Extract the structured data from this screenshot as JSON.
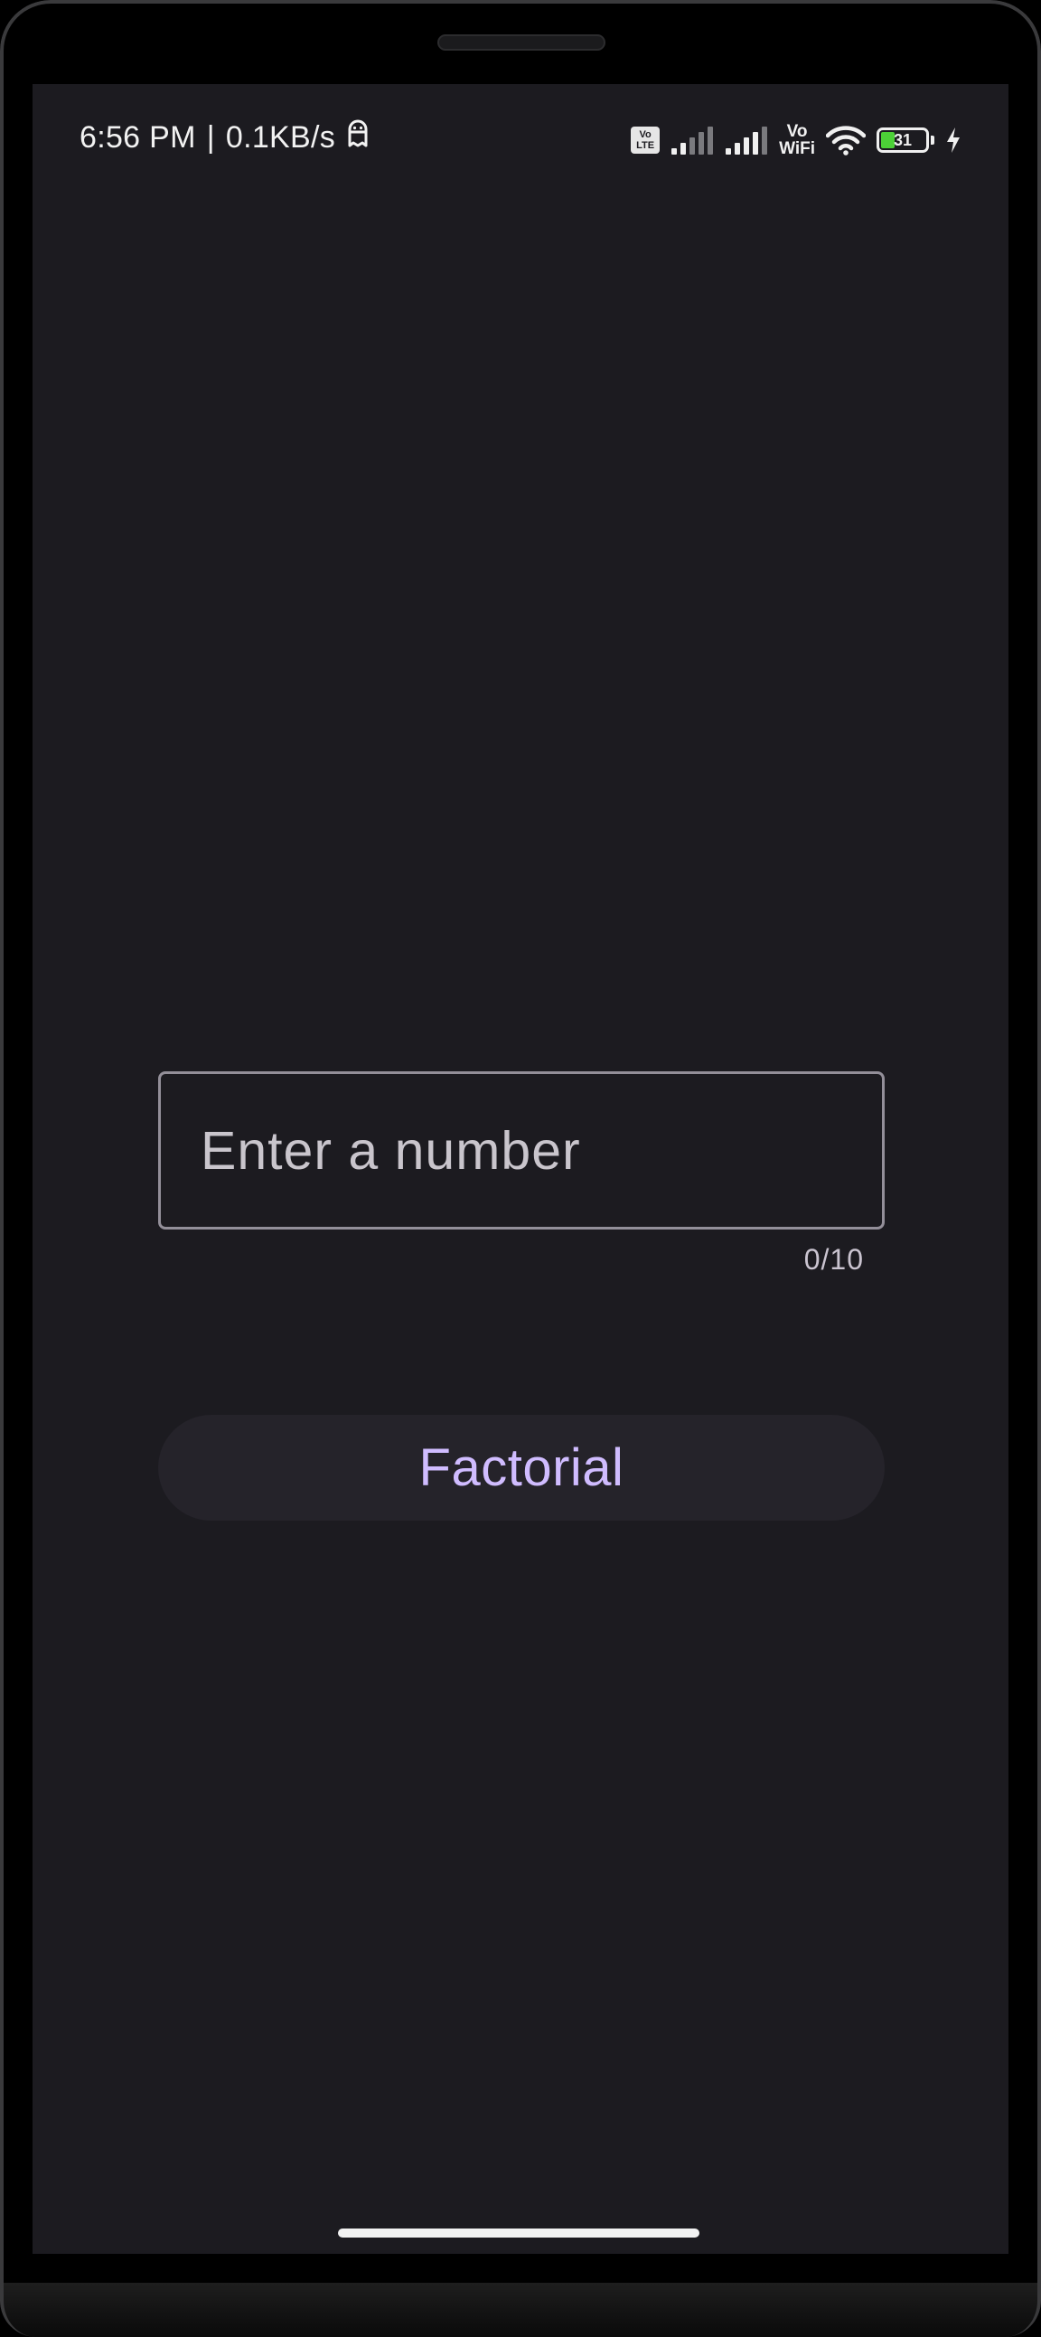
{
  "status_bar": {
    "time": "6:56 PM",
    "separator": "|",
    "network_speed": "0.1KB/s",
    "volte_badge": [
      "Vo",
      "LTE"
    ],
    "vowifi_label": [
      "Vo",
      "WiFi"
    ],
    "battery_level": "31",
    "battery_percent": 31,
    "icons": [
      "ghost-icon",
      "volte-icon",
      "signal-icon",
      "signal-icon",
      "vowifi-icon",
      "wifi-icon",
      "battery-icon",
      "charging-icon"
    ]
  },
  "form": {
    "input_placeholder": "Enter a number",
    "input_value": "",
    "char_counter": "0/10",
    "button_label": "Factorial"
  },
  "colors": {
    "background": "#1c1b20",
    "outline": "#938f99",
    "button_bg": "#25232a",
    "button_text": "#d0bcff",
    "battery_fill": "#4cd137"
  }
}
